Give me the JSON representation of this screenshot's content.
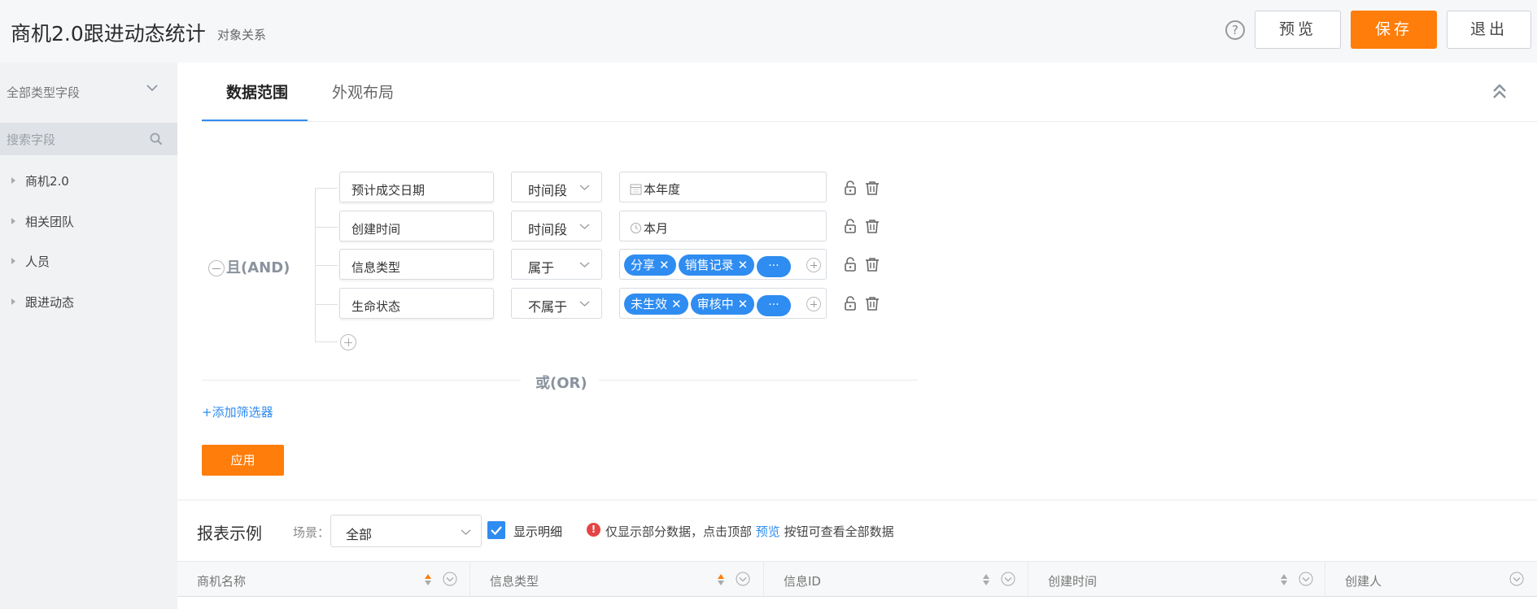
{
  "header": {
    "title": "商机2.0跟进动态统计",
    "subtitle": "对象关系",
    "help_label": "?",
    "preview_label": "预览",
    "save_label": "保存",
    "exit_label": "退出"
  },
  "sidebar": {
    "field_type": "全部类型字段",
    "search_placeholder": "搜索字段",
    "items": [
      {
        "label": "商机2.0"
      },
      {
        "label": "相关团队"
      },
      {
        "label": "人员"
      },
      {
        "label": "跟进动态"
      }
    ]
  },
  "tabs": [
    {
      "label": "数据范围",
      "active": true
    },
    {
      "label": "外观布局",
      "active": false
    }
  ],
  "filter": {
    "and_label": "且(AND)",
    "conditions": [
      {
        "field": "预计成交日期",
        "operator": "时间段",
        "value": "本年度",
        "value_icon": "calendar-icon"
      },
      {
        "field": "创建时间",
        "operator": "时间段",
        "value": "本月",
        "value_icon": "clock-icon"
      },
      {
        "field": "信息类型",
        "operator": "属于",
        "tags": [
          "分享",
          "销售记录"
        ],
        "more": "···"
      },
      {
        "field": "生命状态",
        "operator": "不属于",
        "tags": [
          "未生效",
          "审核中"
        ],
        "more": "···"
      }
    ],
    "or_label": "或(OR)",
    "add_filter_label": "+添加筛选器",
    "apply_label": "应用"
  },
  "report": {
    "title": "报表示例",
    "scene_label": "场景：",
    "scene_value": "全部",
    "show_detail_label": "显示明细",
    "show_detail_checked": true,
    "notice_before": "仅显示部分数据，点击顶部",
    "notice_link": "预览",
    "notice_after": "按钮可查看全部数据",
    "columns": [
      {
        "label": "商机名称",
        "sort_active": true
      },
      {
        "label": "信息类型",
        "sort_active": true
      },
      {
        "label": "信息ID",
        "sort_active": false
      },
      {
        "label": "创建时间",
        "sort_active": false
      },
      {
        "label": "创建人",
        "sort_active": false
      }
    ]
  },
  "colors": {
    "accent": "#ff7d0a",
    "primary": "#2f8cf0",
    "warning": "#e54545"
  }
}
